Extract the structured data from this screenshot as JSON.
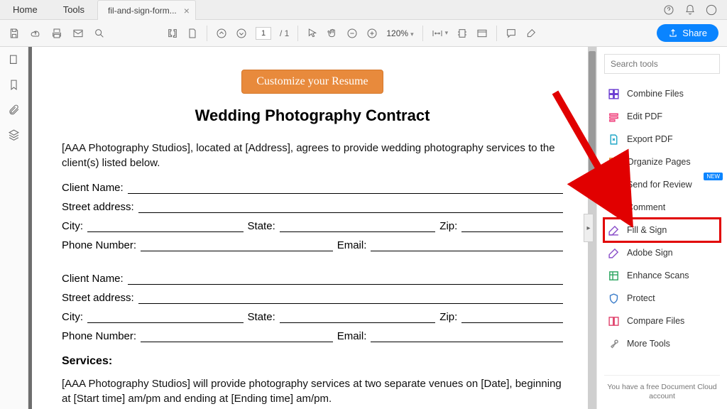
{
  "app_tabs": {
    "home": "Home",
    "tools": "Tools",
    "doc": "fil-and-sign-form..."
  },
  "toolbar": {
    "page_current": "1",
    "page_total": "1",
    "zoom": "120%"
  },
  "share_label": "Share",
  "right": {
    "search_placeholder": "Search tools",
    "tools": [
      {
        "label": "Combine Files",
        "color": "#6a3bd1"
      },
      {
        "label": "Edit PDF",
        "color": "#ef3e7a"
      },
      {
        "label": "Export PDF",
        "color": "#21a7c7"
      },
      {
        "label": "Organize Pages",
        "color": "#e08b23"
      },
      {
        "label": "Send for Review",
        "color": "#f0b400",
        "new": "NEW"
      },
      {
        "label": "Comment",
        "color": "#f0b400"
      },
      {
        "label": "Fill & Sign",
        "color": "#8a4fc9",
        "highlight": true
      },
      {
        "label": "Adobe Sign",
        "color": "#8a4fc9"
      },
      {
        "label": "Enhance Scans",
        "color": "#2aa55f"
      },
      {
        "label": "Protect",
        "color": "#3a7cc9"
      },
      {
        "label": "Compare Files",
        "color": "#e0456e"
      },
      {
        "label": "More Tools",
        "color": "#8a8a8a"
      }
    ],
    "cloud_note": "You have a free Document Cloud account"
  },
  "doc": {
    "resume_btn": "Customize your Resume",
    "title": "Wedding Photography Contract",
    "intro": "[AAA Photography Studios], located at [Address], agrees to provide wedding photography services to the client(s) listed below.",
    "labels": {
      "client_name": "Client Name:",
      "street": "Street address:",
      "city": "City:",
      "state": "State:",
      "zip": "Zip:",
      "phone": "Phone Number:",
      "email": "Email:",
      "services": "Services:"
    },
    "services_p": "[AAA Photography Studios] will provide photography services at two separate venues on [Date], beginning at [Start time] am/pm and ending at [Ending time] am/pm."
  }
}
